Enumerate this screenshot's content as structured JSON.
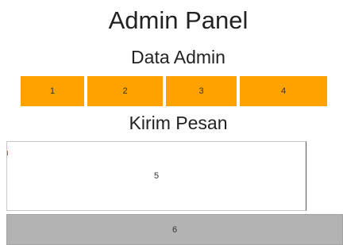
{
  "page": {
    "title": "Admin Panel"
  },
  "sections": {
    "admin_data": "Data Admin",
    "send_message": "Kirim Pesan"
  },
  "tabs": [
    {
      "label": "1"
    },
    {
      "label": "2"
    },
    {
      "label": "3"
    },
    {
      "label": "4"
    }
  ],
  "message": {
    "box_label": "5"
  },
  "send_button": {
    "label": "6"
  },
  "colors": {
    "tab_bg": "#ffa200",
    "button_bg": "#b3b3b3",
    "text": "#222222"
  }
}
